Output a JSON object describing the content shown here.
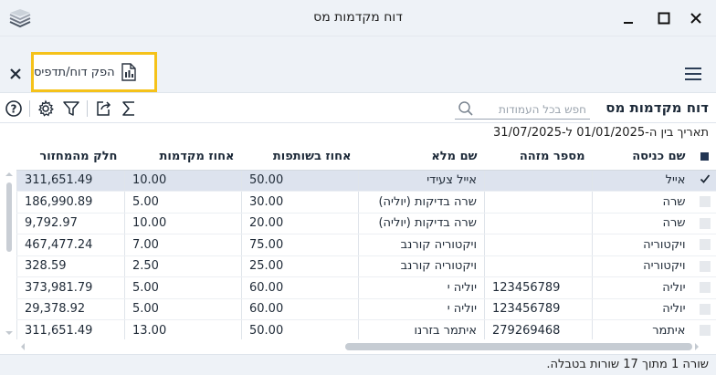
{
  "window": {
    "title": "דוח מקדמות מס"
  },
  "toolbar": {
    "report_button_label": "הפק דוח/תדפיס"
  },
  "header": {
    "section_title": "דוח מקדמות מס",
    "search_placeholder": "חפש בכל העמודות",
    "date_range": "תאריך בין ה-01/01/2025 ל-31/07/2025"
  },
  "table": {
    "columns": [
      "שם כניסה",
      "מספר מזהה",
      "שם מלא",
      "אחוז בשותפות",
      "אחוז מקדמות",
      "חלק מהמחזור"
    ],
    "rows": [
      {
        "login": "אייל",
        "id": "",
        "full_name": "אייל צעידי",
        "partnership": "50.00",
        "advance": "10.00",
        "share": "311,651.49",
        "checked": true
      },
      {
        "login": "שרה",
        "id": "",
        "full_name": "שרה בדיקות (יוליה)",
        "partnership": "30.00",
        "advance": "5.00",
        "share": "186,990.89",
        "checked": false
      },
      {
        "login": "שרה",
        "id": "",
        "full_name": "שרה בדיקות (יוליה)",
        "partnership": "20.00",
        "advance": "10.00",
        "share": "9,792.97",
        "checked": false
      },
      {
        "login": "ויקטוריה",
        "id": "",
        "full_name": "ויקטוריה קורנב",
        "partnership": "75.00",
        "advance": "7.00",
        "share": "467,477.24",
        "checked": false
      },
      {
        "login": "ויקטוריה",
        "id": "",
        "full_name": "ויקטוריה קורנב",
        "partnership": "25.00",
        "advance": "2.50",
        "share": "328.59",
        "checked": false
      },
      {
        "login": "יוליה",
        "id": "123456789",
        "full_name": "יוליה י",
        "partnership": "60.00",
        "advance": "5.00",
        "share": "373,981.79",
        "checked": false
      },
      {
        "login": "יוליה",
        "id": "123456789",
        "full_name": "יוליה י",
        "partnership": "60.00",
        "advance": "5.00",
        "share": "29,378.92",
        "checked": false
      },
      {
        "login": "איתמר",
        "id": "279269468",
        "full_name": "איתמר בזרנו",
        "partnership": "50.00",
        "advance": "13.00",
        "share": "311,651.49",
        "checked": false
      }
    ]
  },
  "status": {
    "text": "שורה 1 מתוך 17 שורות בטבלה."
  },
  "colors": {
    "accent_highlight": "#f5c21a",
    "selected_row": "#dde3ee",
    "chrome": "#eef2f7"
  }
}
